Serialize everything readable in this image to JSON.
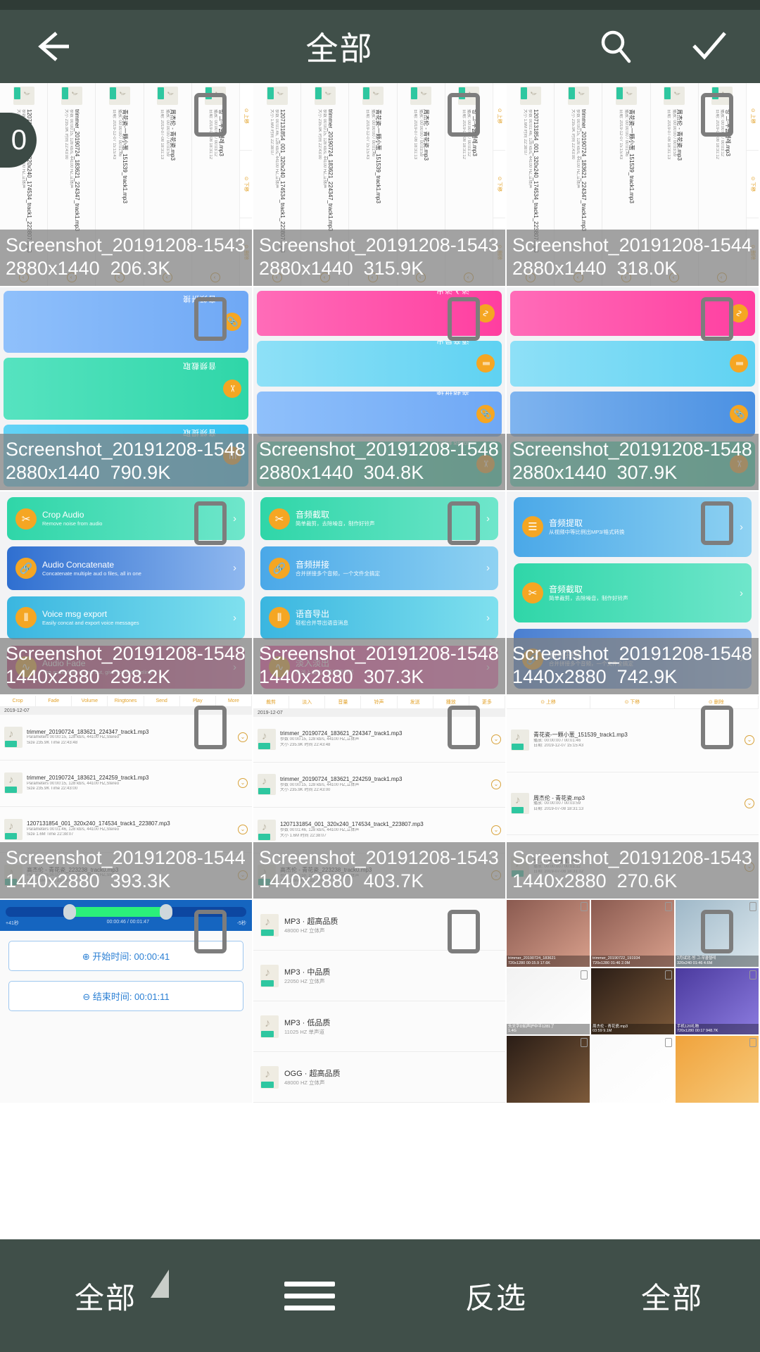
{
  "statusbar": {
    "present": true
  },
  "header": {
    "title": "全部",
    "back_icon": "arrow-left-icon",
    "search_icon": "search-icon",
    "confirm_icon": "check-icon"
  },
  "selection": {
    "count": "0"
  },
  "colors": {
    "header_bg": "#404f49",
    "statusbar_bg": "#2f3b36",
    "caption_overlay": "rgba(128,128,128,0.72)",
    "checkbox_border": "#7d7d7d",
    "accent_orange": "#f5a623",
    "accent_teal": "#2ec7a0",
    "accent_pink": "#ff4aa3",
    "accent_blue": "#4a90e2"
  },
  "grid": {
    "columns": 3,
    "items": [
      {
        "name": "Screenshot_20191208-1543",
        "dimensions": "2880x1440",
        "size": "206.3K",
        "kind": "audio-list-rot",
        "checked": false
      },
      {
        "name": "Screenshot_20191208-1543",
        "dimensions": "2880x1440",
        "size": "315.9K",
        "kind": "audio-list-rot",
        "checked": false
      },
      {
        "name": "Screenshot_20191208-1544",
        "dimensions": "2880x1440",
        "size": "318.0K",
        "kind": "audio-list-rot",
        "checked": false
      },
      {
        "name": "Screenshot_20191208-1548",
        "dimensions": "2880x1440",
        "size": "790.9K",
        "kind": "strips-cn",
        "checked": false
      },
      {
        "name": "Screenshot_20191208-1548",
        "dimensions": "2880x1440",
        "size": "304.8K",
        "kind": "strips-cn2",
        "checked": false
      },
      {
        "name": "Screenshot_20191208-1548",
        "dimensions": "2880x1440",
        "size": "307.9K",
        "kind": "strips-en",
        "checked": false
      },
      {
        "name": "Screenshot_20191208-1548",
        "dimensions": "1440x2880",
        "size": "298.2K",
        "kind": "cards-en",
        "checked": false
      },
      {
        "name": "Screenshot_20191208-1548",
        "dimensions": "1440x2880",
        "size": "307.3K",
        "kind": "cards-cn",
        "checked": false
      },
      {
        "name": "Screenshot_20191208-1548",
        "dimensions": "1440x2880",
        "size": "742.9K",
        "kind": "cards-cn2",
        "checked": false
      },
      {
        "name": "Screenshot_20191208-1544",
        "dimensions": "1440x2880",
        "size": "393.3K",
        "kind": "list-en",
        "checked": false
      },
      {
        "name": "Screenshot_20191208-1543",
        "dimensions": "1440x2880",
        "size": "403.7K",
        "kind": "list-cn",
        "checked": false
      },
      {
        "name": "Screenshot_20191208-1543",
        "dimensions": "1440x2880",
        "size": "270.6K",
        "kind": "list-kr",
        "checked": false
      },
      {
        "name": "",
        "dimensions": "",
        "size": "",
        "kind": "trim",
        "checked": false
      },
      {
        "name": "",
        "dimensions": "",
        "size": "",
        "kind": "quality",
        "checked": false
      },
      {
        "name": "",
        "dimensions": "",
        "size": "",
        "kind": "photos",
        "checked": false
      }
    ]
  },
  "mocks": {
    "audio_list_rot": {
      "tabs": [
        "上移",
        "下移",
        "删除"
      ],
      "rows": [
        {
          "name": "빙 그-우쿨렐레.mp3",
          "meta1": "播放: 00:00:00 / 00:03:12",
          "meta2": "日期: 2019-07-08 18:31:12"
        },
        {
          "name": "周杰伦 - 青花瓷.mp3",
          "meta1": "播放: 00:00:00 / 00:03:59",
          "meta2": "日期: 2019-07-08 18:31:13"
        },
        {
          "name": "青花瓷-一颗小葱_151539_track1.mp3",
          "meta1": "播放: 00:00:00 / 00:01:46",
          "meta2": "日期: 2019-12-07 15:15:43"
        },
        {
          "name": "trimmer_20190724_183621_224347_track1.mp3",
          "meta1": "参数 00:00:15, 128 kb/s, 44100 HZ,立体声",
          "meta2": "大小 235.9K  时间 22:43:00"
        },
        {
          "name": "1207131854_001_320x240_174534_track1_223807.mp3",
          "meta1": "参数 00:01:46, 128 kb/s, 44100 HZ,立体声",
          "meta2": "大小 1.6M  时间 22:38:07"
        }
      ]
    },
    "strips_cn": [
      {
        "title": "音频拼接",
        "sub": "合并拼接多个音频，一个文件全搞定",
        "color1": "#6fa8f5",
        "color2": "#8fc0fb",
        "icon": "link-icon"
      },
      {
        "title": "音频截取",
        "sub": "简单裁剪，去除噪音，制作好铃声",
        "color1": "#2fd6a8",
        "color2": "#56e3c0",
        "icon": "scissors-icon"
      },
      {
        "title": "音频提取",
        "sub": "从视频中等比例出MP3/格式转换",
        "color1": "#35c2f0",
        "color2": "#63d3f6",
        "icon": "extract-icon"
      }
    ],
    "strips_cn2": [
      {
        "title": "淡入淡出",
        "sub": "来淡入淡出，柔和更自然",
        "color1": "#ff3ea0",
        "color2": "#ff6cb8",
        "icon": "wave-icon"
      },
      {
        "title": "语音导出",
        "sub": "轻松合并导出语音消息",
        "color1": "#5fd2f2",
        "color2": "#8ee0f7",
        "icon": "voice-icon"
      },
      {
        "title": "音频拼接",
        "sub": "合并拼接多个音频，一个文件全搞定",
        "color1": "#6fa8f5",
        "color2": "#8fc0fb",
        "icon": "link-icon"
      },
      {
        "title": "音频截取",
        "sub": "简单裁剪，去除噪音，制作好铃声",
        "color1": "#2fd6a8",
        "color2": "#56e3c0",
        "icon": "scissors-icon"
      }
    ],
    "strips_en": [
      {
        "title": "Audio Fade",
        "sub": "The audio fade in and out, give you soft feeling",
        "color1": "#ff3ea0",
        "color2": "#ff6cb8",
        "icon": "wave-icon"
      },
      {
        "title": "Voice msg export",
        "sub": "Easily concat and export voice messages",
        "color1": "#5fd2f2",
        "color2": "#8ee0f7",
        "icon": "voice-icon"
      },
      {
        "title": "Audio Concatenate",
        "sub": "Concatenate multiple aud o files, all in one",
        "color1": "#4a90e2",
        "color2": "#7fb4ef",
        "icon": "link-icon"
      },
      {
        "title": "Crop Audio",
        "sub": "Remove noise from audio",
        "color1": "#2fd6a8",
        "color2": "#56e3c0",
        "icon": "scissors-icon"
      }
    ],
    "cards_en": [
      {
        "title": "Crop Audio",
        "sub": "Remove noise from audio",
        "color1": "#2fd6a8",
        "color2": "#6fe6cb",
        "icon": "scissors-icon"
      },
      {
        "title": "Audio Concatenate",
        "sub": "Concatenate multiple aud o files, all in one",
        "color1": "#2f6fd0",
        "color2": "#8fb8ef",
        "icon": "link-icon"
      },
      {
        "title": "Voice msg export",
        "sub": "Easily concat and export voice messages",
        "color1": "#3ab6e0",
        "color2": "#7fe0ee",
        "icon": "voice-icon"
      },
      {
        "title": "Audio Fade",
        "sub": "The audio fade in and out, give you soft feeling",
        "color1": "#c2316f",
        "color2": "#e05fa0",
        "icon": "wave-icon"
      }
    ],
    "cards_cn": [
      {
        "title": "音频截取",
        "sub": "简单裁剪，去除噪音，制作好铃声",
        "color1": "#2fd6a8",
        "color2": "#6fe6cb",
        "icon": "scissors-icon"
      },
      {
        "title": "音频拼接",
        "sub": "合并拼接多个音频，一个文件全搞定",
        "color1": "#4aa8e8",
        "color2": "#8fd2f2",
        "icon": "link-icon"
      },
      {
        "title": "语音导出",
        "sub": "轻松合并导出语音消息",
        "color1": "#3ab6e0",
        "color2": "#7fe0ee",
        "icon": "voice-icon"
      },
      {
        "title": "淡入淡出",
        "sub": "来淡入淡出，柔和更自然",
        "color1": "#ff3ea0",
        "color2": "#ff6cb8",
        "icon": "wave-icon"
      }
    ],
    "cards_cn2": [
      {
        "title": "音频提取",
        "sub": "从视频中等比例出MP3/格式转换",
        "color1": "#4aa8e8",
        "color2": "#8fd2f2",
        "icon": "extract-icon"
      },
      {
        "title": "音频截取",
        "sub": "简单裁剪，去除噪音，制作好铃声",
        "color1": "#2fd6a8",
        "color2": "#6fe6cb",
        "icon": "scissors-icon"
      },
      {
        "title": "音频拼接",
        "sub": "合并拼接多个音频，一个文件全搞定",
        "color1": "#4a7fd0",
        "color2": "#8fb8ef",
        "icon": "link-icon"
      }
    ],
    "list_en": {
      "toolbar": [
        "Crop",
        "Fade",
        "Volume",
        "Ringtones",
        "Send",
        "Play",
        "More"
      ],
      "datebar": "2019-12-07",
      "rows": [
        {
          "name": "trimmer_20190724_183621_224347_track1.mp3",
          "meta1": "Parameters 00:00:15, 128 kb/s, 44100 HZ,Stereo",
          "meta2": "Size 235.9K  Time 22:43:48"
        },
        {
          "name": "trimmer_20190724_183621_224259_track1.mp3",
          "meta1": "Parameters 00:00:15, 128 kb/s, 44100 HZ,Stereo",
          "meta2": "Size 235.9K  Time 22:43:00"
        },
        {
          "name": "1207131854_001_320x240_174534_track1_223807.mp3",
          "meta1": "Parameters 00:01:46, 128 kb/s, 44100 HZ,Stereo",
          "meta2": "Size 1.6M  Time 22:38:07"
        },
        {
          "name": "高杰伦 - 青花瓷_223238_track0.mp3",
          "meta1": "Parameters 00:03:59, 128 kb/s, 44100 HZ,Stereo",
          "meta2": "Size 1.6M  Time 22:38:07"
        }
      ]
    },
    "list_cn": {
      "toolbar": [
        "裁剪",
        "淡入",
        "音量",
        "铃声",
        "发送",
        "播放",
        "更多"
      ],
      "datebar": "2019-12-07",
      "rows": [
        {
          "name": "trimmer_20190724_183621_224347_track1.mp3",
          "meta1": "参数 00:00:15, 128 kb/s, 44100 HZ,立体声",
          "meta2": "大小 235.9K  时间 22:43:48"
        },
        {
          "name": "trimmer_20190724_183621_224259_track1.mp3",
          "meta1": "参数 00:00:15, 128 kb/s, 44100 HZ,立体声",
          "meta2": "大小 235.9K  时间 22:43:00"
        },
        {
          "name": "1207131854_001_320x240_174534_track1_223807.mp3",
          "meta1": "参数 00:01:46, 128 kb/s, 44100 HZ,立体声",
          "meta2": "大小 1.6M  时间 22:38:07"
        },
        {
          "name": "高杰伦 - 青花瓷_223238_track0.mp3",
          "meta1": "参数 00:03:59, 128 kb/s, 44100 HZ,立体声",
          "meta2": "大小 1.6M  时间 22:38:07"
        }
      ]
    },
    "list_kr": {
      "tabs": [
        "上移",
        "下移",
        "删除"
      ],
      "rows": [
        {
          "name": "青花瓷-一颗小葱_151539_track1.mp3",
          "meta1": "播放: 00:00:00 / 00:01:46",
          "meta2": "日期: 2019-12-07 15:15:43"
        },
        {
          "name": "周杰伦 - 青花瓷.mp3",
          "meta1": "播放: 00:00:00 / 00:03:59",
          "meta2": "日期: 2019-07-08 18:31:13"
        },
        {
          "name": "빙 그-우쿨렐레.mp3",
          "meta1": "播放: 00:00:00 / 00:03:12",
          "meta2": "日期: 2019-07-08 18:31:12"
        }
      ]
    },
    "trim": {
      "left_label": "+41秒",
      "center_label": "00:00:46 / 00:01:47",
      "right_label": "-5秒",
      "start_button": "⊕ 开始时间: 00:00:41",
      "end_button": "⊖ 结束时间: 00:01:11"
    },
    "quality": [
      {
        "t1": "MP3 · 超高品质",
        "t2": "48000 HZ 立体声"
      },
      {
        "t1": "MP3 · 中品质",
        "t2": "22050 HZ 立体声"
      },
      {
        "t1": "MP3 · 低品质",
        "t2": "11025 HZ 单声道"
      },
      {
        "t1": "OGG · 超高品质",
        "t2": "48000 HZ 立体声"
      }
    ],
    "photos": [
      {
        "cap": "trimmer_20190724_183621\n720x1280 00:15.9 17.6K",
        "c1": "#8a5a50",
        "c2": "#d9a08c"
      },
      {
        "cap": "trimmer_20190722_191934\n720x1280 01:46 2.0M",
        "c1": "#8a5a50",
        "c2": "#d9a08c"
      },
      {
        "cap": "2月试北·빙 그-우쿨렐레\n320x240 01:46 4.6M",
        "c1": "#9fb8c8",
        "c2": "#dce8ee"
      },
      {
        "cap": "头文字D如声护中平1281了\n1.4G",
        "c1": "#f2f2f2",
        "c2": "#ffffff"
      },
      {
        "cap": "周杰伦 - 青花瓷.mp3\n03:59 9.1M",
        "c1": "#2a1d16",
        "c2": "#7d5a3a"
      },
      {
        "cap": "手机120礼物\n720x1280 00:17 948.7K",
        "c1": "#4b3a9e",
        "c2": "#8c7ce0"
      },
      {
        "cap": "",
        "c1": "#2a1d16",
        "c2": "#7d5a3a"
      },
      {
        "cap": "",
        "c1": "#fafafa",
        "c2": "#ffffff"
      },
      {
        "cap": "",
        "c1": "#f0a33c",
        "c2": "#f7c97a"
      }
    ]
  },
  "bottombar": {
    "left_label": "全部",
    "menu_icon": "hamburger-icon",
    "invert_label": "反选",
    "all_label": "全部",
    "dropdown_icon": "triangle-icon"
  }
}
